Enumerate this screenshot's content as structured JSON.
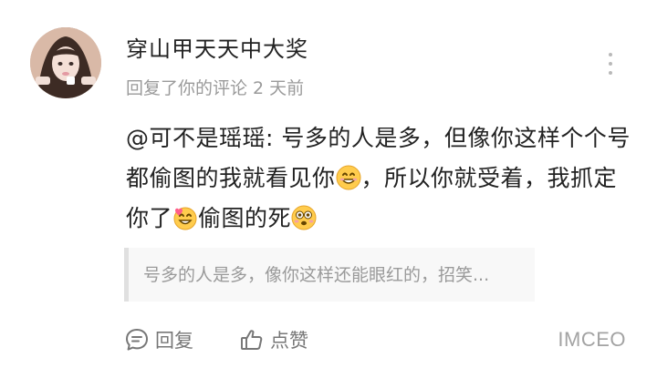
{
  "user": {
    "name": "穿山甲天天中大奖",
    "meta": "回复了你的评论 2 天前"
  },
  "comment": {
    "part1": "@可不是瑶瑶: 号多的人是多，但像你这样个个号都偷图的我就看见你",
    "emoji1": "grinning-face-emoji",
    "part2": "，所以你就受着，我抓定你了",
    "emoji2": "heart-grinning-face-emoji",
    "part3": "偷图的死",
    "emoji3": "flushed-face-emoji"
  },
  "quote": {
    "text": "号多的人是多，像你这样还能眼红的，招笑..."
  },
  "actions": {
    "reply_label": "回复",
    "like_label": "点赞"
  },
  "watermark": "IMCEO"
}
